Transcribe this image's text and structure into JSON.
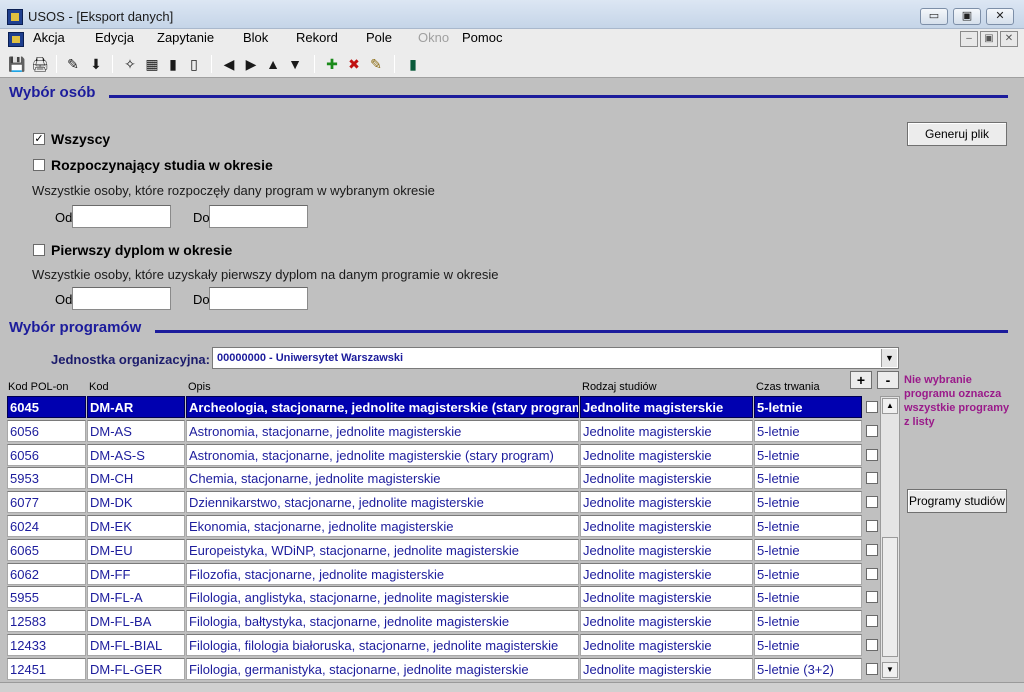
{
  "window": {
    "title": "USOS - [Eksport danych]",
    "buttons": [
      "▭",
      "▣",
      "✕"
    ]
  },
  "menu": [
    {
      "label": "Akcja",
      "disabled": false
    },
    {
      "label": "Edycja",
      "disabled": false
    },
    {
      "label": "Zapytanie",
      "disabled": false
    },
    {
      "label": "Blok",
      "disabled": false
    },
    {
      "label": "Rekord",
      "disabled": false
    },
    {
      "label": "Pole",
      "disabled": false
    },
    {
      "label": "Okno",
      "disabled": true
    },
    {
      "label": "Pomoc",
      "disabled": false
    }
  ],
  "mdi_buttons": [
    "–",
    "▣",
    "✕"
  ],
  "toolbar": {
    "icons": [
      "save-icon",
      "print-icon",
      "edit-icon",
      "download-icon",
      "query-icon",
      "grid-icon",
      "bars-icon",
      "bars2-icon",
      "first-icon",
      "next-icon",
      "up-icon",
      "down-icon",
      "insert-record-icon",
      "delete-record-icon",
      "clear-record-icon",
      "exit-icon"
    ],
    "glyphs": [
      "💾",
      "🖨",
      "✎",
      "⬇",
      "✧",
      "▦",
      "▮",
      "▯",
      "◀",
      "▶",
      "▲",
      "▼",
      "✚",
      "✖",
      "✎",
      "▮"
    ]
  },
  "persons": {
    "title": "Wybór osób",
    "all_label": "Wszyscy",
    "all_checked": true,
    "starting_label": "Rozpoczynający studia w okresie",
    "starting_checked": false,
    "starting_desc": "Wszystkie osoby, które rozpoczęły dany program w wybranym okresie",
    "from_label": "Od",
    "to_label": "Do",
    "from1_value": "",
    "to1_value": "",
    "diploma_label": "Pierwszy dyplom w okresie",
    "diploma_checked": false,
    "diploma_desc": "Wszystkie osoby, które uzyskały pierwszy dyplom na danym programie w okresie",
    "from2_value": "",
    "to2_value": "",
    "generate_button": "Generuj plik"
  },
  "programs": {
    "title": "Wybór programów",
    "org_label": "Jednostka organizacyjna:",
    "org_value": "00000000 - Uniwersytet Warszawski",
    "columns": [
      "Kod POL-on",
      "Kod",
      "Opis",
      "Rodzaj studiów",
      "Czas trwania"
    ],
    "plus": "+",
    "minus": "-",
    "note": "Nie wybranie programu oznacza wszystkie programy z listy",
    "programs_button": "Programy studiów",
    "rows": [
      {
        "polon": "6045",
        "kod": "DM-AR",
        "opis": "Archeologia, stacjonarne, jednolite magisterskie (stary program)",
        "rodzaj": "Jednolite magisterskie",
        "czas": "5-letnie",
        "selected": true
      },
      {
        "polon": "6056",
        "kod": "DM-AS",
        "opis": "Astronomia, stacjonarne, jednolite magisterskie",
        "rodzaj": "Jednolite magisterskie",
        "czas": "5-letnie",
        "selected": false
      },
      {
        "polon": "6056",
        "kod": "DM-AS-S",
        "opis": "Astronomia, stacjonarne, jednolite magisterskie (stary program)",
        "rodzaj": "Jednolite magisterskie",
        "czas": "5-letnie",
        "selected": false
      },
      {
        "polon": "5953",
        "kod": "DM-CH",
        "opis": "Chemia, stacjonarne, jednolite magisterskie",
        "rodzaj": "Jednolite magisterskie",
        "czas": "5-letnie",
        "selected": false
      },
      {
        "polon": "6077",
        "kod": "DM-DK",
        "opis": "Dziennikarstwo, stacjonarne, jednolite magisterskie",
        "rodzaj": "Jednolite magisterskie",
        "czas": "5-letnie",
        "selected": false
      },
      {
        "polon": "6024",
        "kod": "DM-EK",
        "opis": "Ekonomia, stacjonarne, jednolite magisterskie",
        "rodzaj": "Jednolite magisterskie",
        "czas": "5-letnie",
        "selected": false
      },
      {
        "polon": "6065",
        "kod": "DM-EU",
        "opis": "Europeistyka, WDiNP, stacjonarne, jednolite magisterskie",
        "rodzaj": "Jednolite magisterskie",
        "czas": "5-letnie",
        "selected": false
      },
      {
        "polon": "6062",
        "kod": "DM-FF",
        "opis": "Filozofia, stacjonarne, jednolite magisterskie",
        "rodzaj": "Jednolite magisterskie",
        "czas": "5-letnie",
        "selected": false
      },
      {
        "polon": "5955",
        "kod": "DM-FL-A",
        "opis": "Filologia, anglistyka, stacjonarne, jednolite magisterskie",
        "rodzaj": "Jednolite magisterskie",
        "czas": "5-letnie",
        "selected": false
      },
      {
        "polon": "12583",
        "kod": "DM-FL-BA",
        "opis": "Filologia, bałtystyka, stacjonarne, jednolite magisterskie",
        "rodzaj": "Jednolite magisterskie",
        "czas": "5-letnie",
        "selected": false
      },
      {
        "polon": "12433",
        "kod": "DM-FL-BIAL",
        "opis": "Filologia, filologia białoruska, stacjonarne, jednolite magisterskie",
        "rodzaj": "Jednolite magisterskie",
        "czas": "5-letnie",
        "selected": false
      },
      {
        "polon": "12451",
        "kod": "DM-FL-GER",
        "opis": "Filologia, germanistyka, stacjonarne, jednolite magisterskie",
        "rodzaj": "Jednolite magisterskie",
        "czas": "5-letnie (3+2)",
        "selected": false
      }
    ]
  }
}
